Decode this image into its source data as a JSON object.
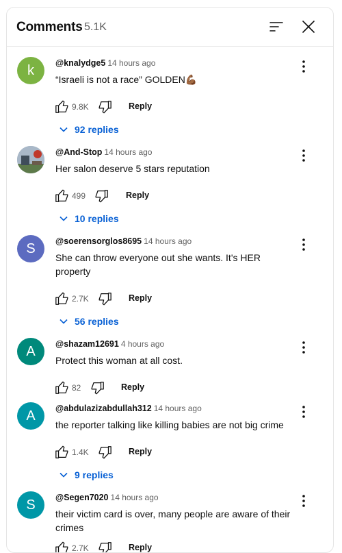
{
  "header": {
    "title": "Comments",
    "count": "5.1K"
  },
  "comments": [
    {
      "author": "@knalydge5",
      "time": "14 hours ago",
      "text": "“Israeli is not a race” GOLDEN💪🏾",
      "likes": "9.8K",
      "reply": "Reply",
      "replies": "92 replies",
      "avatar_letter": "k",
      "avatar_color": "#7cb342"
    },
    {
      "author": "@And-Stop",
      "time": "14 hours ago",
      "text": "Her salon deserve 5 stars reputation",
      "likes": "499",
      "reply": "Reply",
      "replies": "10 replies",
      "avatar_letter": "",
      "avatar_color": "#8a9bb0"
    },
    {
      "author": "@soerensorglos8695",
      "time": "14 hours ago",
      "text": "She can throw everyone out she wants. It's HER property",
      "likes": "2.7K",
      "reply": "Reply",
      "replies": "56 replies",
      "avatar_letter": "S",
      "avatar_color": "#5c6bc0"
    },
    {
      "author": "@shazam12691",
      "time": "4 hours ago",
      "text": "Protect this woman at all cost.",
      "likes": "82",
      "reply": "Reply",
      "replies": "",
      "avatar_letter": "A",
      "avatar_color": "#00897b"
    },
    {
      "author": "@abdulazizabdullah312",
      "time": "14 hours ago",
      "text": "the reporter talking like killing babies are not big crime",
      "likes": "1.4K",
      "reply": "Reply",
      "replies": "9 replies",
      "avatar_letter": "A",
      "avatar_color": "#0097a7"
    },
    {
      "author": "@Segen7020",
      "time": "14 hours ago",
      "text": "their victim card is over, many people are aware of their crimes",
      "likes": "2.7K",
      "reply": "Reply",
      "replies": "",
      "avatar_letter": "S",
      "avatar_color": "#0097a7"
    }
  ]
}
